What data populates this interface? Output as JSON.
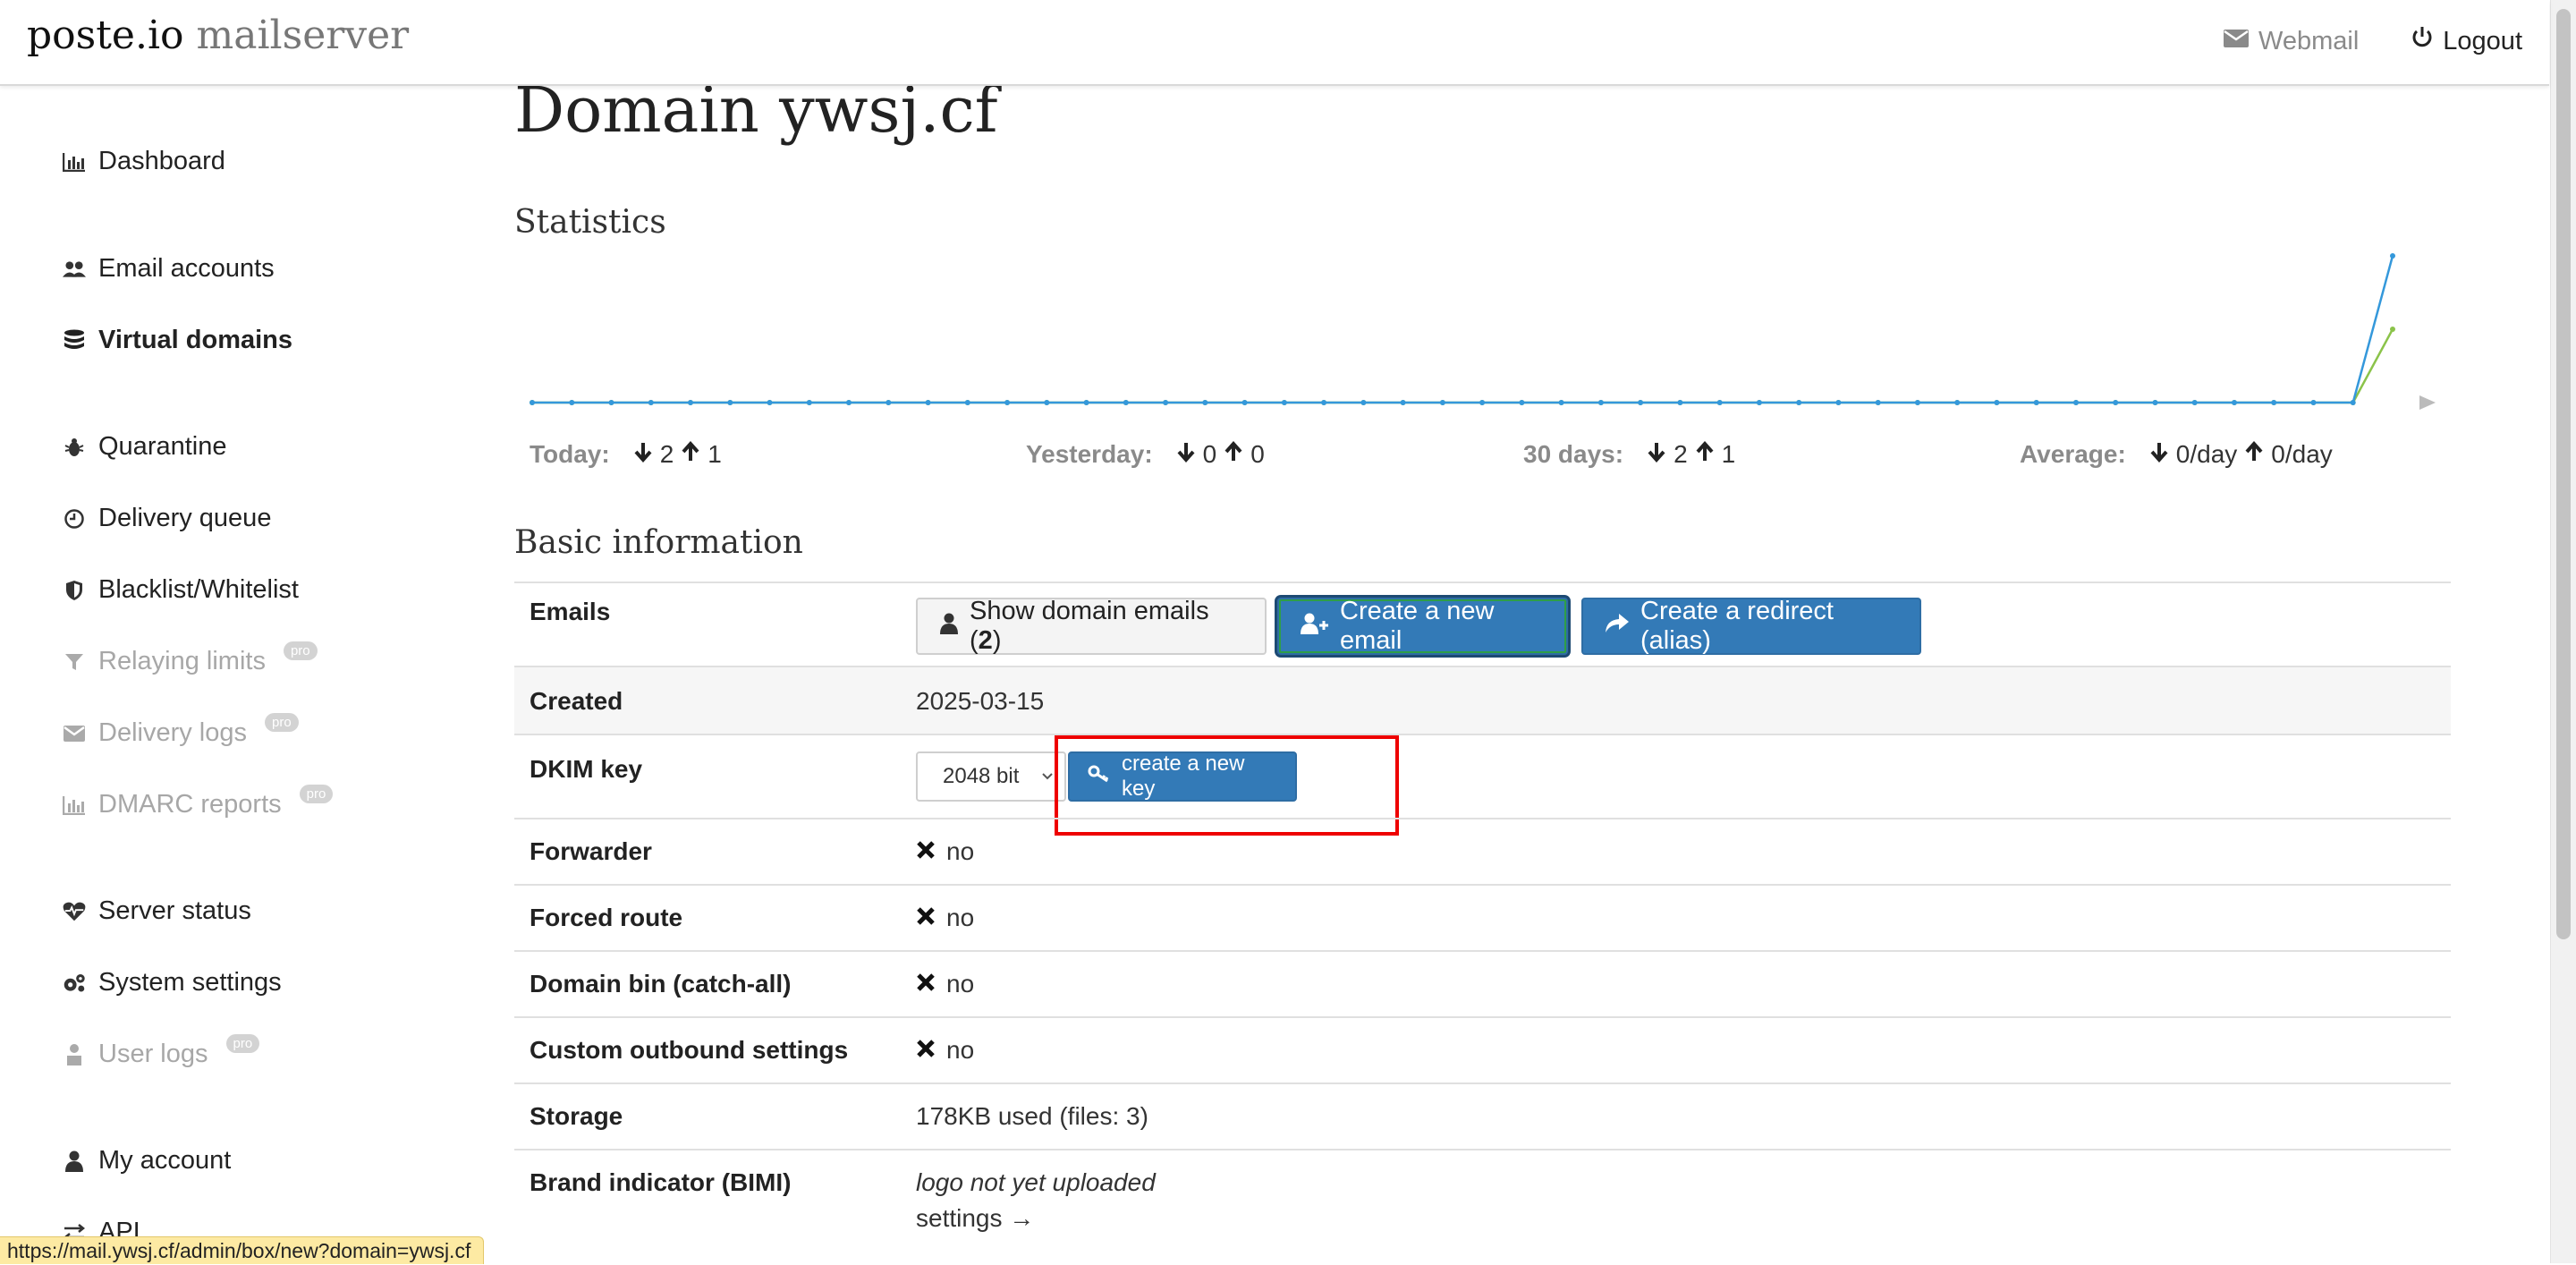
{
  "brand": {
    "name": "poste.io",
    "suffix": "mailserver"
  },
  "topnav": {
    "webmail": "Webmail",
    "logout": "Logout"
  },
  "sidebar": {
    "items": [
      {
        "label": "Dashboard",
        "icon": "bar-chart-icon"
      },
      {
        "label": "Email accounts",
        "icon": "users-icon"
      },
      {
        "label": "Virtual domains",
        "icon": "database-icon",
        "active": true
      },
      {
        "label": "Quarantine",
        "icon": "bug-icon"
      },
      {
        "label": "Delivery queue",
        "icon": "clock-icon"
      },
      {
        "label": "Blacklist/Whitelist",
        "icon": "shield-icon"
      },
      {
        "label": "Relaying limits",
        "icon": "filter-icon",
        "pro": "pro"
      },
      {
        "label": "Delivery logs",
        "icon": "envelope-icon",
        "pro": "pro"
      },
      {
        "label": "DMARC reports",
        "icon": "bar-chart-icon",
        "pro": "pro"
      },
      {
        "label": "Server status",
        "icon": "heartbeat-icon"
      },
      {
        "label": "System settings",
        "icon": "gears-icon"
      },
      {
        "label": "User logs",
        "icon": "user-icon",
        "pro": "pro"
      },
      {
        "label": "My account",
        "icon": "user-icon"
      },
      {
        "label": "API",
        "icon": "arrows-icon"
      }
    ]
  },
  "page": {
    "title": "Domain ywsj.cf",
    "statistics_title": "Statistics",
    "basic_title": "Basic information"
  },
  "stats": {
    "today": {
      "label": "Today:",
      "in": "2",
      "out": "1"
    },
    "yesterday": {
      "label": "Yesterday:",
      "in": "0",
      "out": "0"
    },
    "month": {
      "label": "30 days:",
      "in": "2",
      "out": "1"
    },
    "average": {
      "label": "Average:",
      "in": "0/day",
      "out": "0/day"
    }
  },
  "chart_data": {
    "type": "line",
    "x": [
      1,
      2,
      3,
      4,
      5,
      6,
      7,
      8,
      9,
      10,
      11,
      12,
      13,
      14,
      15,
      16,
      17,
      18,
      19,
      20,
      21,
      22,
      23,
      24,
      25,
      26,
      27,
      28,
      29,
      30,
      31,
      32,
      33,
      34,
      35,
      36,
      37,
      38,
      39,
      40,
      41,
      42,
      43,
      44,
      45,
      46,
      47,
      48
    ],
    "series": [
      {
        "color": "#3498db",
        "values": [
          0,
          0,
          0,
          0,
          0,
          0,
          0,
          0,
          0,
          0,
          0,
          0,
          0,
          0,
          0,
          0,
          0,
          0,
          0,
          0,
          0,
          0,
          0,
          0,
          0,
          0,
          0,
          0,
          0,
          0,
          0,
          0,
          0,
          0,
          0,
          0,
          0,
          0,
          0,
          0,
          0,
          0,
          0,
          0,
          0,
          0,
          0,
          2
        ]
      },
      {
        "color": "#8bc34a",
        "values": [
          0,
          0,
          0,
          0,
          0,
          0,
          0,
          0,
          0,
          0,
          0,
          0,
          0,
          0,
          0,
          0,
          0,
          0,
          0,
          0,
          0,
          0,
          0,
          0,
          0,
          0,
          0,
          0,
          0,
          0,
          0,
          0,
          0,
          0,
          0,
          0,
          0,
          0,
          0,
          0,
          0,
          0,
          0,
          0,
          0,
          0,
          0,
          1
        ]
      }
    ],
    "ylim": [
      0,
      2
    ],
    "grid": false,
    "legend": "none"
  },
  "table": {
    "emails": {
      "label": "Emails",
      "show_btn_text": "Show domain emails (",
      "show_btn_count": "2",
      "show_btn_close": ")",
      "create_email": "Create a new email",
      "create_redirect": "Create a redirect (alias)"
    },
    "created": {
      "label": "Created",
      "value": "2025-03-15"
    },
    "dkim": {
      "label": "DKIM key",
      "select_value": "2048 bit",
      "create_key": "create a new key"
    },
    "forwarder": {
      "label": "Forwarder",
      "value": "no"
    },
    "forced_route": {
      "label": "Forced route",
      "value": "no"
    },
    "domain_bin": {
      "label": "Domain bin (catch-all)",
      "value": "no"
    },
    "custom_outbound": {
      "label": "Custom outbound settings",
      "value": "no"
    },
    "storage": {
      "label": "Storage",
      "value": "178KB used (files: 3)"
    },
    "bimi": {
      "label": "Brand indicator (BIMI)",
      "value": "logo not yet uploaded",
      "link": "settings →"
    }
  },
  "status_url": "https://mail.ywsj.cf/admin/box/new?domain=ywsj.cf"
}
